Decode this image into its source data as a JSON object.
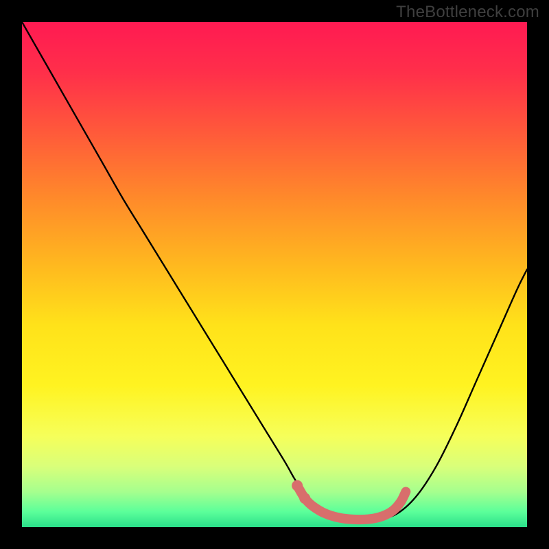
{
  "watermark": {
    "text": "TheBottleneck.com"
  },
  "colors": {
    "frame": "#000000",
    "gradient_stops": [
      {
        "offset": 0.0,
        "color": "#ff1a52"
      },
      {
        "offset": 0.1,
        "color": "#ff2f4a"
      },
      {
        "offset": 0.22,
        "color": "#ff5a3a"
      },
      {
        "offset": 0.35,
        "color": "#ff8a2a"
      },
      {
        "offset": 0.48,
        "color": "#ffb81f"
      },
      {
        "offset": 0.6,
        "color": "#ffe21a"
      },
      {
        "offset": 0.72,
        "color": "#fff321"
      },
      {
        "offset": 0.82,
        "color": "#f6ff5a"
      },
      {
        "offset": 0.88,
        "color": "#d9ff7a"
      },
      {
        "offset": 0.93,
        "color": "#a6ff8e"
      },
      {
        "offset": 0.97,
        "color": "#5bff9a"
      },
      {
        "offset": 1.0,
        "color": "#2bdf8a"
      }
    ],
    "curve": "#000000",
    "highlight": "#d86e6c"
  },
  "chart_data": {
    "type": "line",
    "title": "",
    "xlabel": "",
    "ylabel": "",
    "xlim": [
      0,
      100
    ],
    "ylim": [
      0,
      100
    ],
    "grid": false,
    "legend": false,
    "series": [
      {
        "name": "bottleneck-curve",
        "x": [
          0,
          4,
          8,
          12,
          16,
          20,
          24,
          28,
          32,
          36,
          40,
          44,
          48,
          52,
          54,
          56,
          58,
          62,
          66,
          70,
          74,
          78,
          82,
          86,
          90,
          94,
          98,
          100
        ],
        "y": [
          100,
          93,
          86,
          79,
          72,
          65,
          58.5,
          52,
          45.5,
          39,
          32.5,
          26,
          19.5,
          13,
          9.5,
          6.5,
          4.5,
          2.5,
          1.5,
          1.5,
          2.5,
          6,
          12,
          20,
          29,
          38,
          47,
          51
        ]
      },
      {
        "name": "optimal-range-highlight",
        "x": [
          54.5,
          56.0,
          57.5,
          60.0,
          63.0,
          66.0,
          69.0,
          71.5,
          73.5,
          75.0,
          76.0
        ],
        "y": [
          8.2,
          5.7,
          4.2,
          2.7,
          1.8,
          1.5,
          1.6,
          2.2,
          3.3,
          5.0,
          7.0
        ]
      }
    ],
    "annotations": []
  }
}
